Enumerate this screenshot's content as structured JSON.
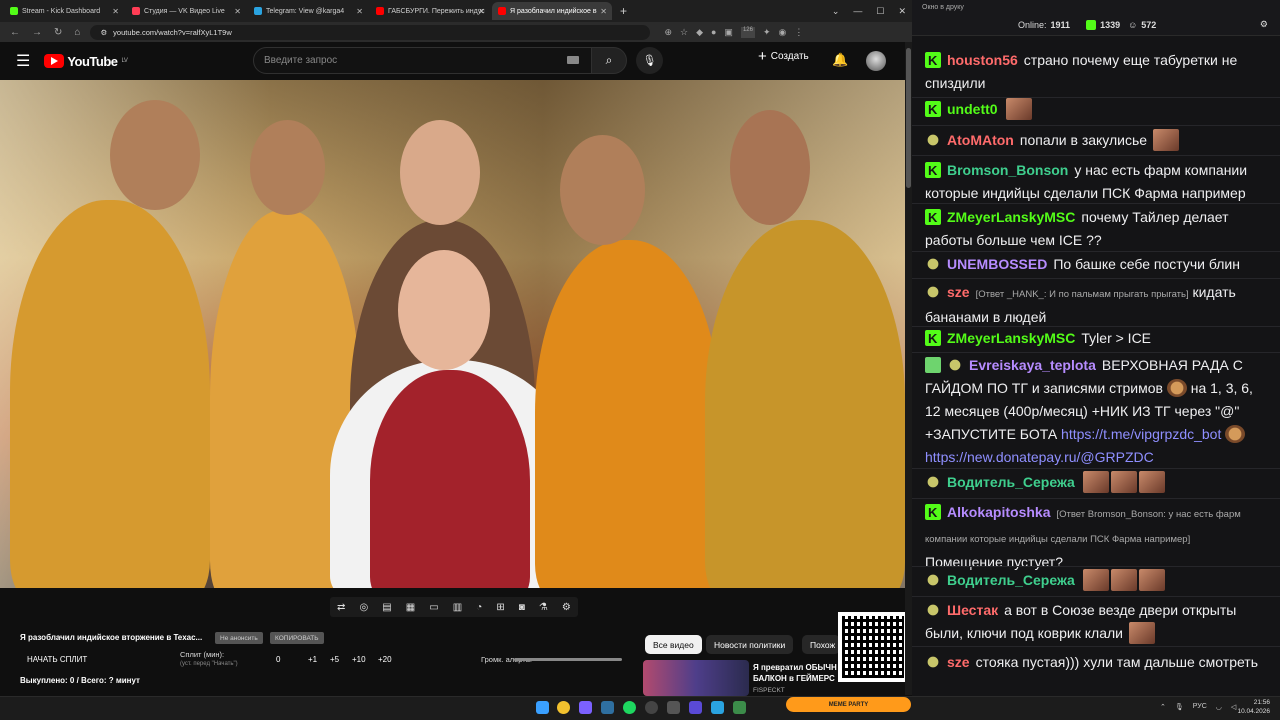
{
  "browser": {
    "tabs": [
      {
        "label": "Stream - Kick Dashboard",
        "fav": "#53fc18"
      },
      {
        "label": "Студия — VK Видео Live",
        "fav": "#ff3d55"
      },
      {
        "label": "Telegram: View @karga4",
        "fav": "#2aa3e0"
      },
      {
        "label": "ГАБСБУРГИ. Пережить индус",
        "fav": "#ff0000"
      },
      {
        "label": "Я разоблачил индийское в",
        "fav": "#ff0000"
      }
    ],
    "new_tab": "+",
    "url": "youtube.com/watch?v=ralfXyL1T9w",
    "ext_badge": "126"
  },
  "youtube": {
    "logo_text": "YouTube",
    "logo_region": "LV",
    "search_placeholder": "Введите запрос",
    "create_label": "Создать"
  },
  "video": {
    "title": "Я разоблачил индийское вторжение в Texac...",
    "chip_hide": "Не анонсить",
    "chip_copy": "КОПИРОВАТЬ",
    "start_split": "НАЧАТЬ СПЛИТ",
    "split_min": "Сплит (мин):",
    "split_hint": "(уст. перед \"Начать\")",
    "split_value": "0",
    "split_add": [
      "+1",
      "+5",
      "+10",
      "+20"
    ],
    "alert_volume": "Громк. алерта:",
    "bought": "Выкуплено: 0 / Всего: ? минут"
  },
  "filters": {
    "all": "Все видео",
    "politics": "Новости политики",
    "similar": "Похож"
  },
  "related": {
    "title": "Я превратил ОБЫЧН БАЛКОН в ГЕЙМЕРС",
    "channel": "FISPECKT"
  },
  "chat": {
    "window_title": "Окно в друку",
    "online_label": "Online:",
    "online_count": "1911",
    "kick_count": "1339",
    "other_count": "572",
    "messages": [
      {
        "name": "houston56",
        "color": "#ff6b6b",
        "text": "страно почему еще табуретки не спиздили",
        "badge": "k"
      },
      {
        "name": "undett0",
        "color": "#53fc18",
        "text": "",
        "badge": "k"
      },
      {
        "name": "AtoMAton",
        "color": "#ff6b6b",
        "text": "попали в закулисье",
        "badge": "s"
      },
      {
        "name": "Bromson_Bonson",
        "color": "#3fcf8e",
        "text": "у нас есть фарм компании которые индийцы сделали ПСК Фарма например",
        "badge": "k"
      },
      {
        "name": "ZMeyerLanskyMSC",
        "color": "#53fc18",
        "text": "почему Тайлер делает работы больше чем ICE ??",
        "badge": "k"
      },
      {
        "name": "UNEMBOSSED",
        "color": "#b68cff",
        "text": "По башке себе постучи блин",
        "badge": "s"
      },
      {
        "name": "sze",
        "color": "#ff6b6b",
        "reply": "[Ответ _HANK_: И по пальмам прыгать прыгать]",
        "text": "кидать бананами в людей",
        "badge": "s"
      },
      {
        "name": "ZMeyerLanskyMSC",
        "color": "#53fc18",
        "text": "Tyler > ICE",
        "badge": "k"
      },
      {
        "name": "Evreiskaya_teplota",
        "color": "#b68cff",
        "text": "ВЕРХОВНАЯ РАДА С ГАЙДОМ ПО ТГ и записями стримов",
        "text2": "на 1, 3, 6, 12 месяцев (400р/месяц) +НИК ИЗ ТГ через \"@\" +ЗАПУСТИТЕ БОТА",
        "link1": "https://t.me/vipgrpzdc_bot",
        "link2": "https://new.donatepay.ru/@GRPZDC",
        "badge": "s"
      },
      {
        "name": "Водитель_Сережа",
        "color": "#3fcf8e",
        "text": "",
        "badge": "s"
      },
      {
        "name": "Alkokapitoshka",
        "color": "#b68cff",
        "reply": "[Ответ Bromson_Bonson: у нас есть фарм компании которые индийцы сделали ПСК Фарма например]",
        "text": "Помещение пустует?",
        "badge": "k"
      },
      {
        "name": "Водитель_Сережа",
        "color": "#3fcf8e",
        "text": "",
        "badge": "s"
      },
      {
        "name": "Шестак",
        "color": "#ff6b6b",
        "text": "а вот в Союзе везде двери открыты были, ключи под коврик клали",
        "badge": "s"
      },
      {
        "name": "sze",
        "color": "#ff6b6b",
        "text": "стояка пустая))) хули там дальше смотреть",
        "badge": "s"
      }
    ]
  },
  "taskbar": {
    "meme_widget": "MEME PARTY",
    "lang": "РУС",
    "time": "21:56",
    "date": "10.04.2026"
  }
}
